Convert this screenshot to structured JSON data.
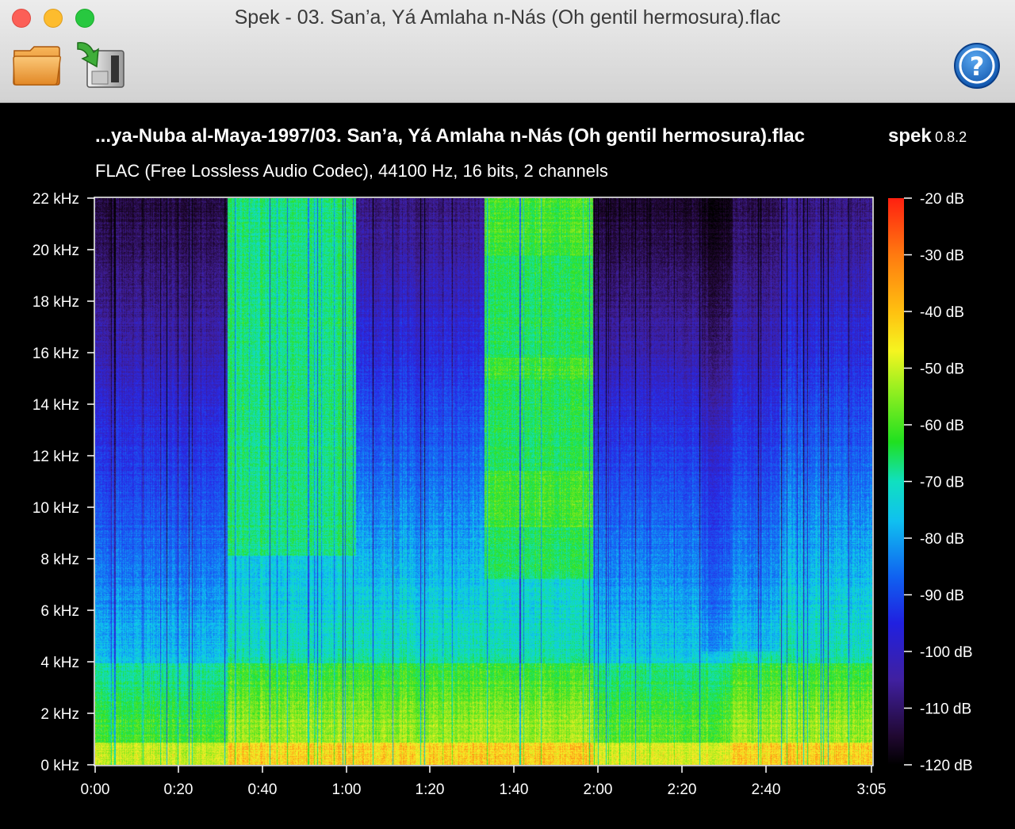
{
  "window": {
    "title": "Spek - 03. San’a, Yá Amlaha n-Nás (Oh gentil hermosura).flac",
    "traffic_lights": [
      "close",
      "minimize",
      "zoom"
    ]
  },
  "toolbar": {
    "open_icon": "folder-icon",
    "save_icon": "save-export-icon",
    "help_icon": "help-icon"
  },
  "header": {
    "file_path": "...ya-Nuba al-Maya-1997/03. San’a, Yá Amlaha n-Nás (Oh gentil hermosura).flac",
    "app_name": "spek",
    "app_version": "0.8.2",
    "audio_info": "FLAC (Free Lossless Audio Codec), 44100 Hz, 16 bits, 2 channels"
  },
  "y_ticks": [
    "22 kHz",
    "20 kHz",
    "18 kHz",
    "16 kHz",
    "14 kHz",
    "12 kHz",
    "10 kHz",
    "8 kHz",
    "6 kHz",
    "4 kHz",
    "2 kHz",
    "0 kHz"
  ],
  "x_ticks": [
    "0:00",
    "0:20",
    "0:40",
    "1:00",
    "1:20",
    "1:40",
    "2:00",
    "2:20",
    "2:40",
    "3:05"
  ],
  "db_ticks": [
    "-20 dB",
    "-30 dB",
    "-40 dB",
    "-50 dB",
    "-60 dB",
    "-70 dB",
    "-80 dB",
    "-90 dB",
    "-100 dB",
    "-110 dB",
    "-120 dB"
  ],
  "colors": {
    "background": "#000000",
    "close": "#fc5f57",
    "minimize": "#fdbc2e",
    "zoom": "#28c840"
  }
}
